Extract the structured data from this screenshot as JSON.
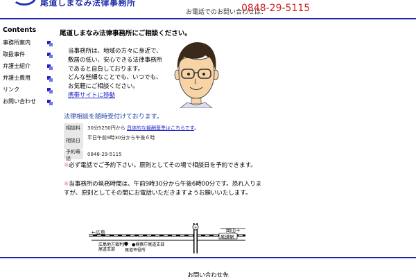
{
  "header": {
    "firm_name": "尾道しまなみ法律事務所",
    "phone_label": "お電話でのお問い合わせは：",
    "phone_number": "0848-29-5115"
  },
  "sidebar": {
    "title": "Contents",
    "items": [
      {
        "label": "事務所案内"
      },
      {
        "label": "取扱事件"
      },
      {
        "label": "弁護士紹介"
      },
      {
        "label": "弁護士費用"
      },
      {
        "label": "リンク"
      },
      {
        "label": "お問い合わせ"
      }
    ]
  },
  "main": {
    "title": "尾道しまなみ法律事務所にご相談ください。",
    "intro_lines": [
      "当事務所は、地域の方々に身近で、",
      "敷居の低い、安心できる法律事務所",
      "であると自負しております。",
      "どんな些細なことでも、いつでも、",
      "お気軽にご相談ください。"
    ],
    "mobile_link": "携帯サイトに移動",
    "consult_heading": "法律相談を随時受付けております。",
    "info": {
      "fee_label": "相談料",
      "fee_value": "30分5250円から",
      "fee_link": "具体的な報酬基準はこちらです",
      "fee_suffix": "。",
      "date_label": "相談日",
      "date_value": "平日午前9時30分から午後６時",
      "tel_label": "予約電話",
      "tel_value": "0848-29-5115"
    },
    "note1_mark": "※",
    "note1": "必ず電話でご予約下さい。原則としてその場で相談日を予約できます。",
    "note2_mark": "※",
    "note2": "当事務所の執務時間は、午前9時30分から午後6時00分です。恐れ入りますが、原則としてその間にお電話いただきますようお願いいたします。"
  },
  "map": {
    "left_label": "←広島",
    "right_label": "岡山→",
    "station": "尾道駅",
    "court": "広島地方裁判所",
    "court2": "尾道支部",
    "office": "●検察庁尾道支部",
    "line2": "尾道市役所"
  },
  "footer": {
    "text": "お問い合わせ先"
  },
  "colors": {
    "accent_blue": "#2222aa",
    "phone_red": "#cc2222",
    "link_blue": "#2222cc",
    "note_pink": "#e87aa8"
  }
}
